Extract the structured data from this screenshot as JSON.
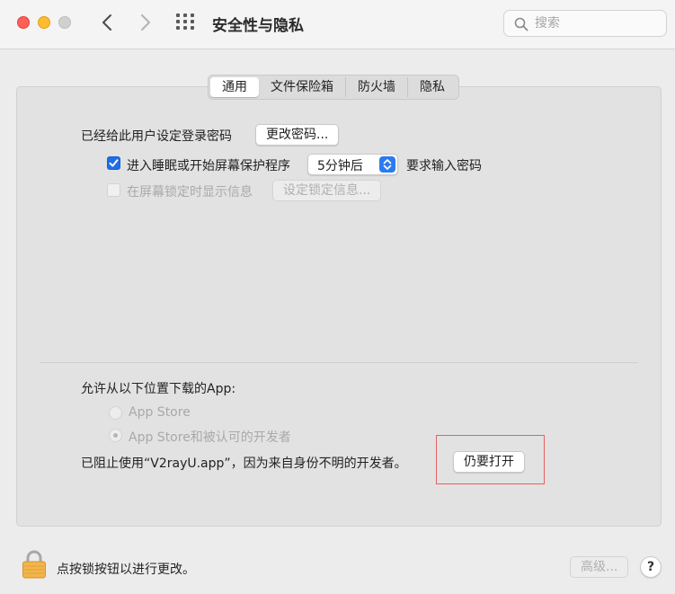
{
  "window": {
    "title": "安全性与隐私"
  },
  "search": {
    "placeholder": "搜索"
  },
  "tabs": [
    {
      "label": "通用",
      "active": true
    },
    {
      "label": "文件保险箱",
      "active": false
    },
    {
      "label": "防火墙",
      "active": false
    },
    {
      "label": "隐私",
      "active": false
    }
  ],
  "general": {
    "password_label": "已经给此用户设定登录密码",
    "change_password_button": "更改密码...",
    "require_password_checkbox_label": "进入睡眠或开始屏幕保护程序",
    "require_password_checked": true,
    "require_password_delay": "5分钟后",
    "require_password_suffix": "要求输入密码",
    "lock_message_checkbox_label": "在屏幕锁定时显示信息",
    "lock_message_checked": false,
    "set_lock_message_button": "设定锁定信息..."
  },
  "downloads": {
    "heading": "允许从以下位置下载的App:",
    "options": [
      {
        "label": "App Store",
        "selected": false
      },
      {
        "label": "App Store和被认可的开发者",
        "selected": true
      }
    ],
    "blocked_message": "已阻止使用“V2rayU.app”，因为来自身份不明的开发者。",
    "open_anyway_button": "仍要打开"
  },
  "footer": {
    "lock_hint": "点按锁按钮以进行更改。",
    "advanced_button": "高级...",
    "help_button": "?"
  },
  "colors": {
    "accent": "#1e6fe6",
    "highlight_box": "#e86060",
    "close": "#fe5f57",
    "minimize": "#febc2e"
  },
  "icons": [
    "back-chevron-icon",
    "forward-chevron-icon",
    "grid-icon",
    "search-icon",
    "checkmark-icon",
    "updown-arrows-icon",
    "padlock-icon"
  ]
}
